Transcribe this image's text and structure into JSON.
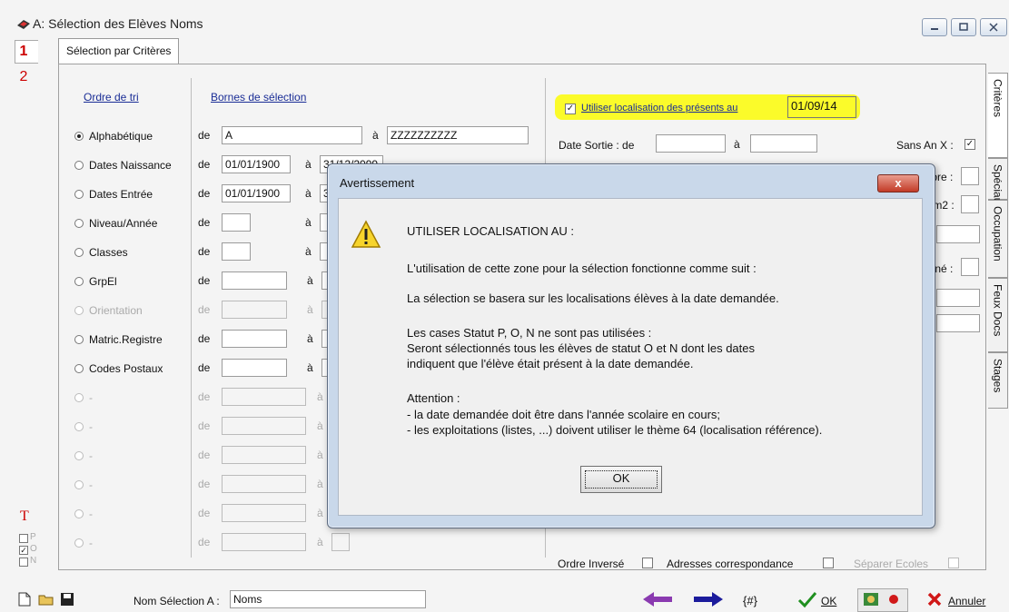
{
  "window": {
    "title": "A: Sélection des Elèves Noms",
    "tab_label": "Sélection par Critères"
  },
  "left_rail": {
    "num1": "1",
    "num2": "2",
    "t_marker": "T",
    "status_p": "P",
    "status_o": "O",
    "status_n": "N"
  },
  "criteria": {
    "sort_header": "Ordre de tri",
    "bounds_header": "Bornes de sélection",
    "de": "de",
    "a": "à",
    "rows": [
      {
        "label": "Alphabétique",
        "from": "A",
        "to": "ZZZZZZZZZZ",
        "selected": true,
        "enabled": true
      },
      {
        "label": "Dates Naissance",
        "from": "01/01/1900",
        "to": "31/12/2099",
        "selected": false,
        "enabled": true
      },
      {
        "label": "Dates Entrée",
        "from": "01/01/1900",
        "to": "3",
        "selected": false,
        "enabled": true
      },
      {
        "label": "Niveau/Année",
        "from": "",
        "to": "",
        "selected": false,
        "enabled": true
      },
      {
        "label": "Classes",
        "from": "",
        "to": "",
        "selected": false,
        "enabled": true
      },
      {
        "label": "GrpEl",
        "from": "",
        "to": "",
        "selected": false,
        "enabled": true
      },
      {
        "label": "Orientation",
        "from": "",
        "to": "",
        "selected": false,
        "enabled": false
      },
      {
        "label": "Matric.Registre",
        "from": "",
        "to": "",
        "selected": false,
        "enabled": true
      },
      {
        "label": "Codes Postaux",
        "from": "",
        "to": "",
        "selected": false,
        "enabled": true
      },
      {
        "label": "-",
        "from": "",
        "to": "",
        "selected": false,
        "enabled": false
      },
      {
        "label": "-",
        "from": "",
        "to": "",
        "selected": false,
        "enabled": false
      },
      {
        "label": "-",
        "from": "",
        "to": "",
        "selected": false,
        "enabled": false
      },
      {
        "label": "-",
        "from": "",
        "to": "",
        "selected": false,
        "enabled": false
      },
      {
        "label": "-",
        "from": "",
        "to": "",
        "selected": false,
        "enabled": false
      },
      {
        "label": "-",
        "from": "",
        "to": "",
        "selected": false,
        "enabled": false
      }
    ]
  },
  "right_panel": {
    "localisation_label": "Utiliser localisation des présents au",
    "localisation_date": "01/09/14",
    "date_sortie": "Date Sortie : de",
    "a": "à",
    "sans_an_x": "Sans An X :",
    "libre": "Libre :",
    "rem2": "Rem2 :",
    "aine": "Aîné :",
    "ordre_inverse": "Ordre Inversé",
    "adresses_corr": "Adresses correspondance",
    "separer_ecoles": "Séparer Ecoles"
  },
  "side_tabs": [
    "Critères",
    "Spéciaux",
    "Occupation",
    "Feux Docs",
    "Stages"
  ],
  "dialog": {
    "title": "Avertissement",
    "close": "x",
    "heading": "UTILISER LOCALISATION AU :",
    "line1": "L'utilisation de cette zone pour la sélection fonctionne comme suit :",
    "line2": "La sélection se basera sur les localisations élèves à la date demandée.",
    "line3": "Les cases Statut P, O, N ne sont pas utilisées :",
    "line4": "Seront sélectionnés tous les élèves de statut O et N dont les dates",
    "line5": "indiquent que l'élève était présent à la date demandée.",
    "line6": "Attention :",
    "line7": "- la date demandée doit être dans l'année scolaire en cours;",
    "line8": "- les exploitations (listes, ...) doivent utiliser le thème 64 (localisation référence).",
    "ok": "OK"
  },
  "bottom": {
    "nom_selection_label": "Nom Sélection A :",
    "nom_selection_value": "Noms",
    "hash": "{#}",
    "ok": "OK",
    "annuler": "Annuler"
  }
}
